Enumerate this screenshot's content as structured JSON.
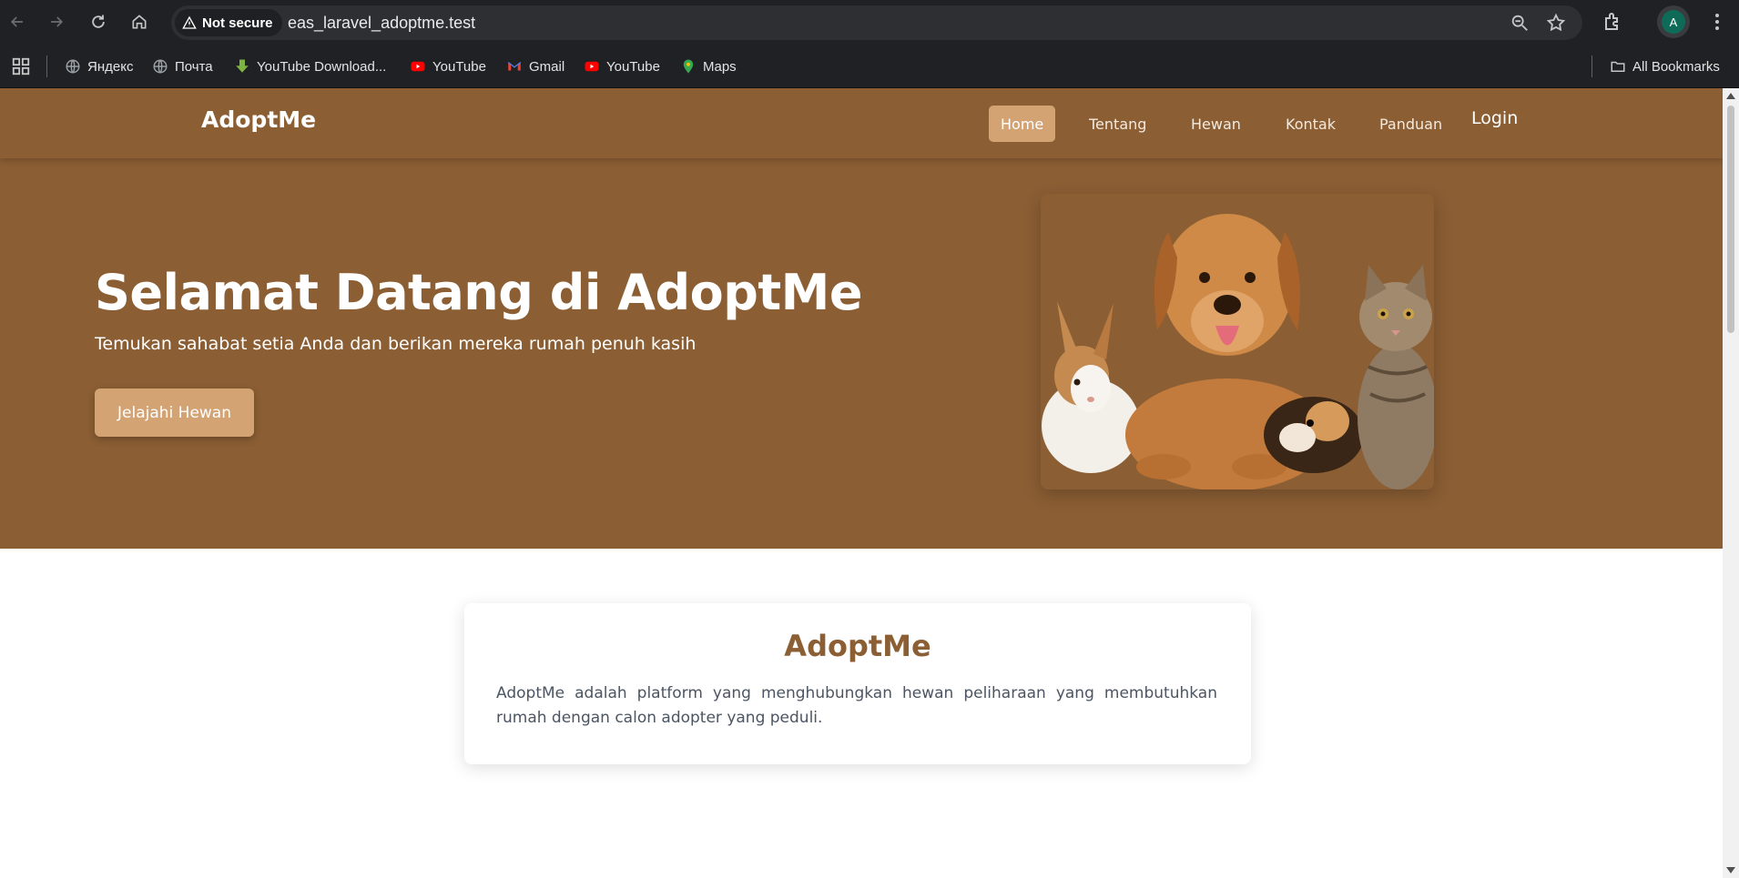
{
  "browser": {
    "security_label": "Not secure",
    "url": "eas_laravel_adoptme.test",
    "profile_initial": "A",
    "bookmarks": [
      {
        "label": "Яндекс",
        "icon": "globe-icon"
      },
      {
        "label": "Почта",
        "icon": "globe-icon"
      },
      {
        "label": "YouTube Download...",
        "icon": "download-arrow-icon"
      },
      {
        "label": "YouTube",
        "icon": "youtube-icon"
      },
      {
        "label": "Gmail",
        "icon": "gmail-icon"
      },
      {
        "label": "YouTube",
        "icon": "youtube-icon"
      },
      {
        "label": "Maps",
        "icon": "maps-pin-icon"
      }
    ],
    "all_bookmarks_label": "All Bookmarks"
  },
  "site": {
    "brand": "AdoptMe",
    "nav": {
      "home": "Home",
      "tentang": "Tentang",
      "hewan": "Hewan",
      "kontak": "Kontak",
      "panduan": "Panduan",
      "login": "Login"
    },
    "hero": {
      "title": "Selamat Datang di AdoptMe",
      "subtitle": "Temukan sahabat setia Anda dan berikan mereka rumah penuh kasih",
      "cta": "Jelajahi Hewan"
    },
    "about": {
      "title": "AdoptMe",
      "text": "AdoptMe adalah platform yang menghubungkan hewan peliharaan yang membutuhkan rumah dengan calon adopter yang peduli."
    }
  },
  "colors": {
    "primary_brown": "#8b5e34",
    "accent_tan": "#d4a373",
    "chrome_dark": "#202124"
  }
}
